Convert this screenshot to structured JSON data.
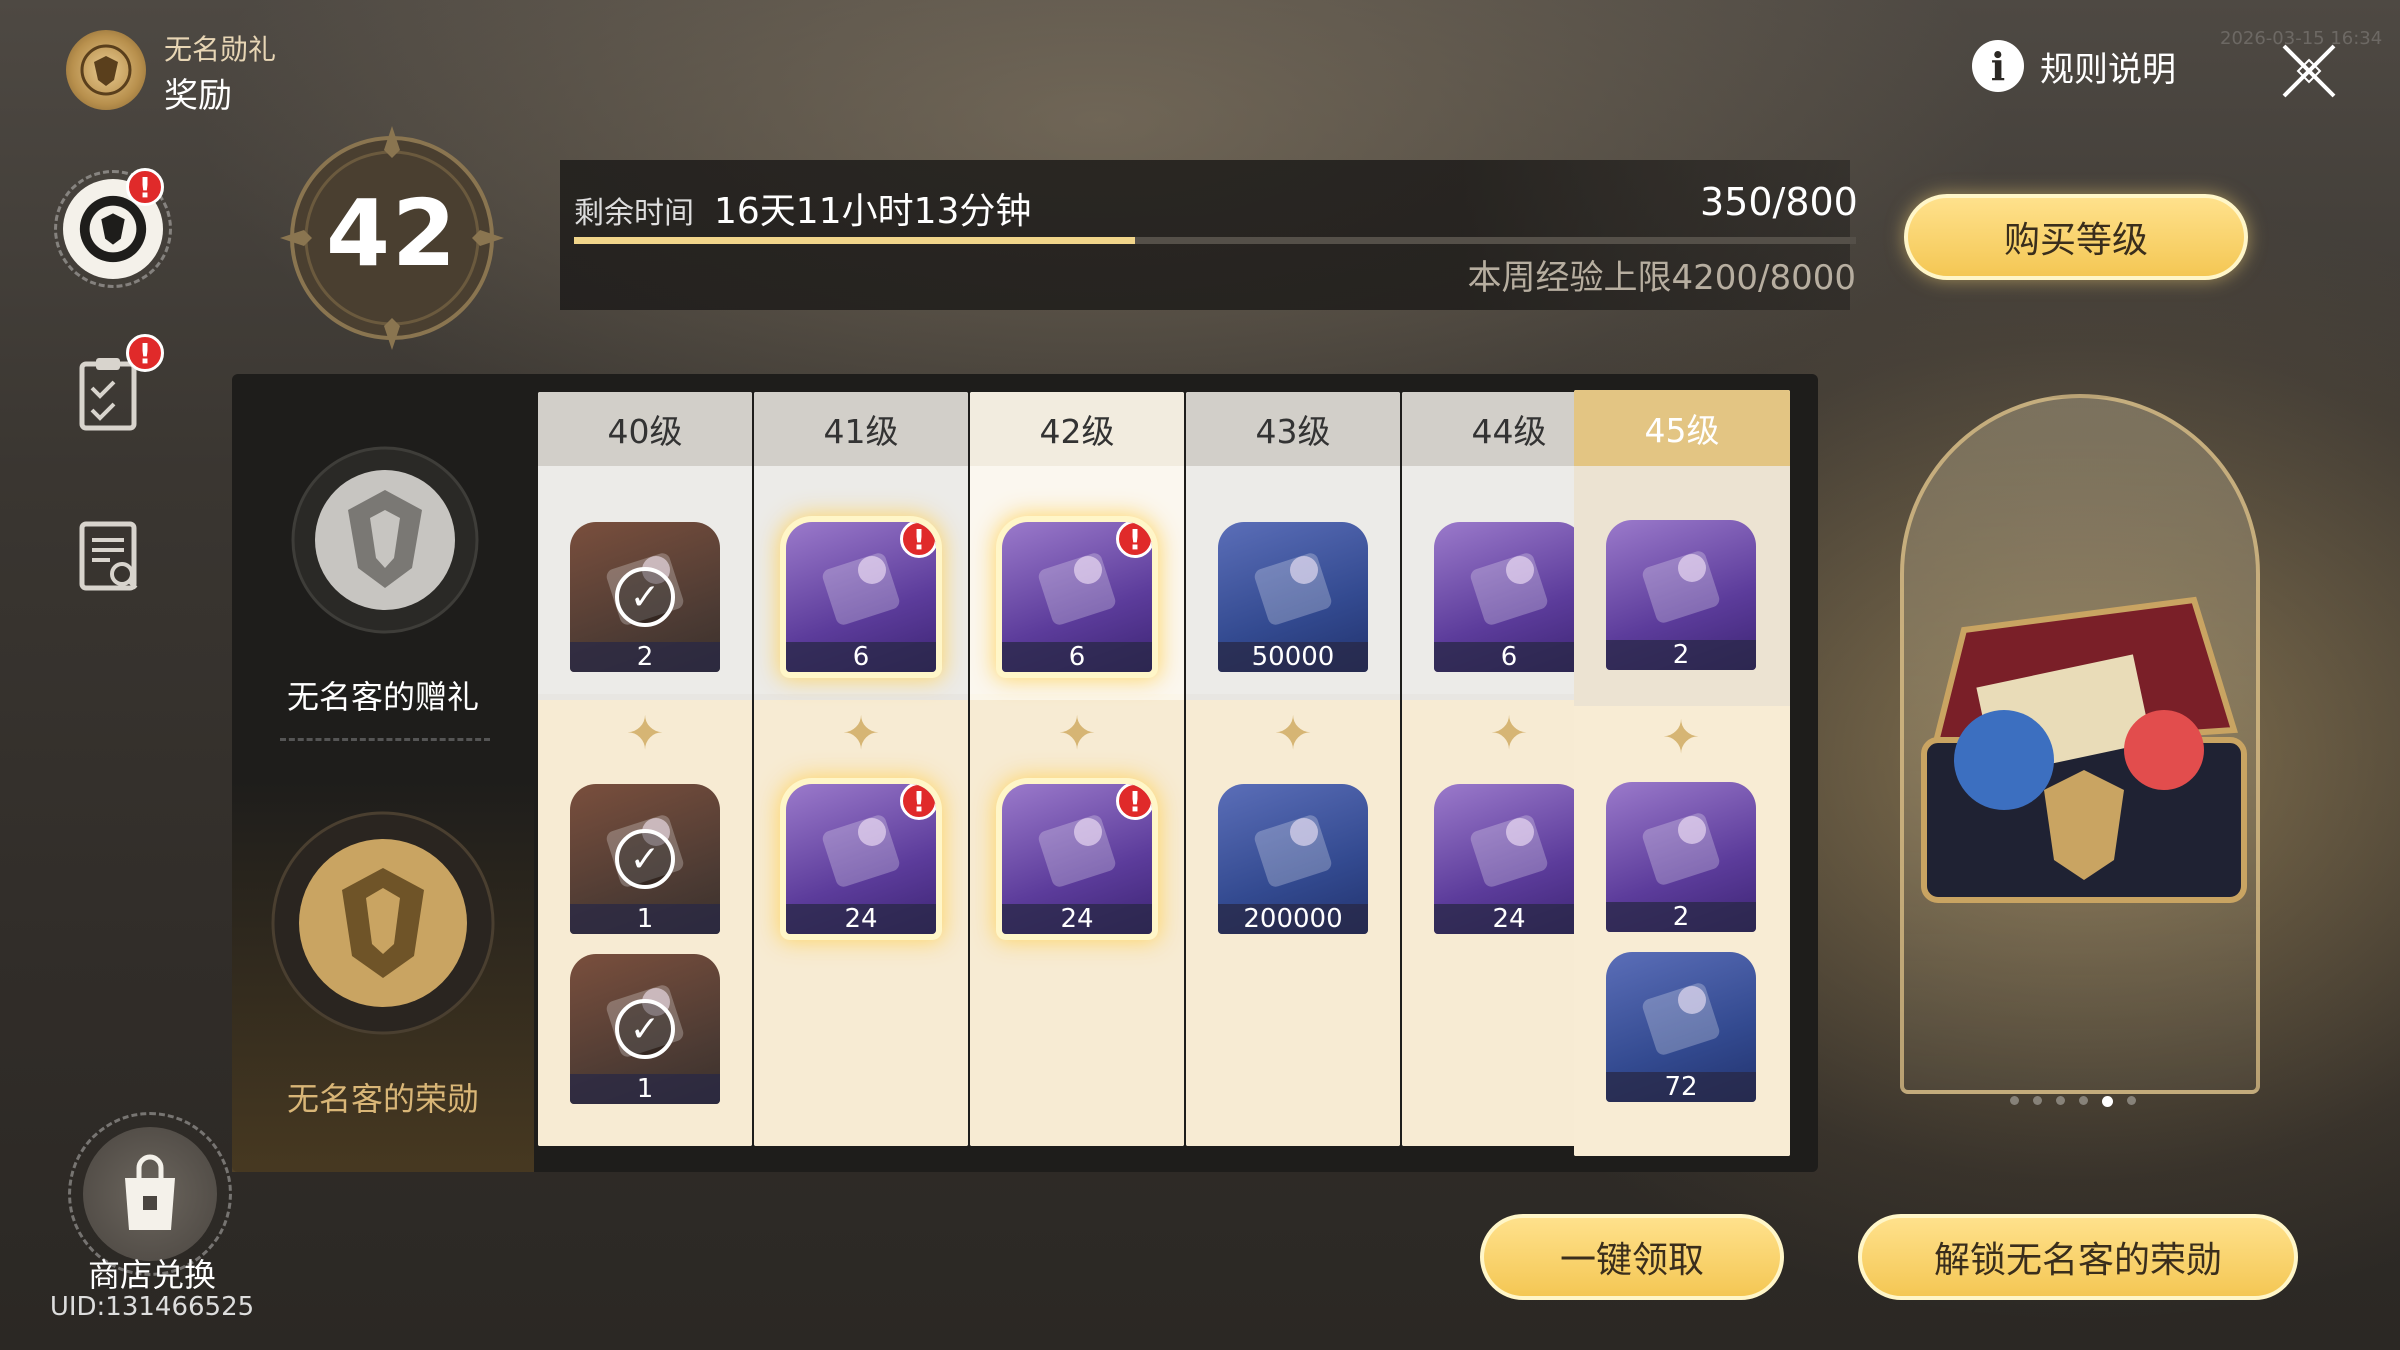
{
  "header": {
    "pass_name": "无名勋礼",
    "title": "奖励",
    "rules_label": "规则说明",
    "timestamp": "2026-03-15 16:34"
  },
  "level": {
    "current": "42",
    "time_label": "剩余时间",
    "time_remaining": "16天11小时13分钟",
    "exp": "350/800",
    "exp_progress": 0.4375,
    "weekly_cap": "本周经验上限4200/8000",
    "buy_button": "购买等级"
  },
  "tiers": {
    "free_label": "无名客的赠礼",
    "premium_label": "无名客的荣勋"
  },
  "columns": [
    {
      "label": "40级",
      "free": [
        {
          "qty": "2",
          "claimed": true
        }
      ],
      "premium": [
        {
          "qty": "1",
          "claimed": true
        },
        {
          "qty": "1",
          "claimed": true
        }
      ]
    },
    {
      "label": "41级",
      "free": [
        {
          "qty": "6",
          "claimable": true
        }
      ],
      "premium": [
        {
          "qty": "24",
          "claimable": true
        }
      ]
    },
    {
      "label": "42级",
      "free": [
        {
          "qty": "6",
          "claimable": true
        }
      ],
      "premium": [
        {
          "qty": "24",
          "claimable": true
        }
      ]
    },
    {
      "label": "43级",
      "free": [
        {
          "qty": "50000"
        }
      ],
      "premium": [
        {
          "qty": "200000"
        }
      ]
    },
    {
      "label": "44级",
      "free": [
        {
          "qty": "6"
        }
      ],
      "premium": [
        {
          "qty": "24"
        }
      ]
    },
    {
      "label": "45级",
      "free": [
        {
          "qty": "2"
        }
      ],
      "premium": [
        {
          "qty": "2"
        },
        {
          "qty": "72"
        }
      ]
    }
  ],
  "actions": {
    "claim_all": "一键领取",
    "unlock": "解锁无名客的荣勋"
  },
  "shop": {
    "label": "商店兑换",
    "uid": "UID:131466525"
  },
  "carousel": {
    "count": 6,
    "active": 4
  },
  "colors": {
    "accent": "#f4c754",
    "badge": "#e02a2a"
  }
}
